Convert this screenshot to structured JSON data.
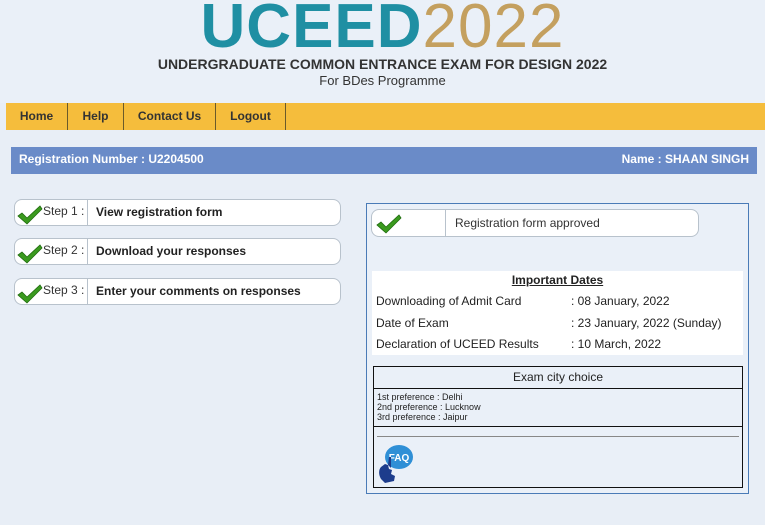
{
  "header": {
    "logo_part1": "UCEED",
    "logo_part2": "2022",
    "title": "UNDERGRADUATE COMMON ENTRANCE EXAM FOR DESIGN 2022",
    "subtitle": "For BDes Programme"
  },
  "nav": {
    "home": "Home",
    "help": "Help",
    "contact": "Contact Us",
    "logout": "Logout"
  },
  "user": {
    "registration": "Registration Number : U2204500",
    "name": "Name : SHAAN SINGH"
  },
  "steps": [
    {
      "label": "Step 1 :",
      "title": "View registration form"
    },
    {
      "label": "Step 2 :",
      "title": "Download your responses"
    },
    {
      "label": "Step 3 :",
      "title": "Enter your comments on responses"
    }
  ],
  "status": {
    "text": "Registration form approved"
  },
  "important_dates": {
    "heading": "Important Dates",
    "rows": [
      {
        "label": "Downloading of Admit Card",
        "value": ": 08 January, 2022"
      },
      {
        "label": "Date of Exam",
        "value": ": 23 January, 2022 (Sunday)"
      },
      {
        "label": "Declaration of UCEED Results",
        "value": ": 10 March, 2022"
      }
    ]
  },
  "exam_city": {
    "heading": "Exam city choice",
    "preferences": [
      "1st preference : Delhi",
      "2nd preference : Lucknow",
      "3rd preference : Jaipur"
    ]
  },
  "faq": {
    "label": "FAQ"
  },
  "colors": {
    "logo_teal": "#1f8fa3",
    "logo_gold": "#c4a05f",
    "nav_bg": "#f5bd3c",
    "reg_bar": "#6a8bc8",
    "check_green": "#3a9a1e",
    "faq_blue": "#2f8fd6"
  }
}
